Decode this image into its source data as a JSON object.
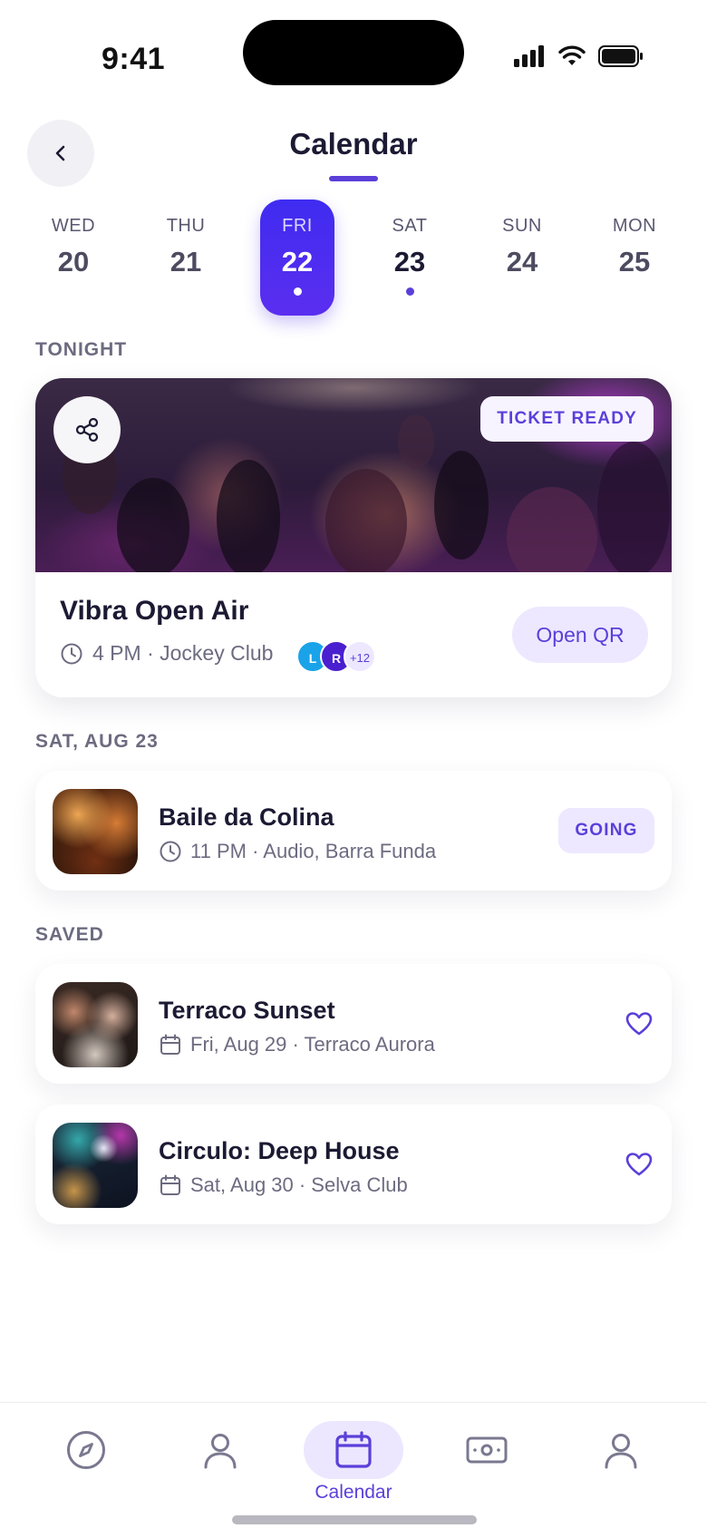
{
  "status_bar": {
    "time": "9:41"
  },
  "header": {
    "title": "Calendar"
  },
  "date_strip": [
    {
      "dow": "WED",
      "num": "20",
      "active": false,
      "dot": false
    },
    {
      "dow": "THU",
      "num": "21",
      "active": false,
      "dot": false
    },
    {
      "dow": "FRI",
      "num": "22",
      "active": true,
      "dot": true
    },
    {
      "dow": "SAT",
      "num": "23",
      "active": false,
      "dot": true
    },
    {
      "dow": "SUN",
      "num": "24",
      "active": false,
      "dot": false
    },
    {
      "dow": "MON",
      "num": "25",
      "active": false,
      "dot": false
    }
  ],
  "tonight": {
    "section_label": "TONIGHT",
    "badge": "TICKET READY",
    "title": "Vibra Open Air",
    "meta": "4 PM · Jockey Club",
    "avatars": [
      {
        "initial": "L",
        "color": "#1aa3e8"
      },
      {
        "initial": "R",
        "color": "#4a1fd0"
      }
    ],
    "avatar_more": "+12",
    "cta": "Open QR"
  },
  "upcoming": {
    "section_label": "SAT, AUG 23",
    "items": [
      {
        "title": "Baile da Colina",
        "meta": "11 PM · Audio, Barra Funda",
        "badge": "GOING"
      }
    ]
  },
  "saved": {
    "section_label": "SAVED",
    "items": [
      {
        "title": "Terraco Sunset",
        "meta": "Fri, Aug 29 · Terraco Aurora"
      },
      {
        "title": "Circulo: Deep House",
        "meta": "Sat, Aug 30 · Selva Club"
      }
    ]
  },
  "tabbar": {
    "items": [
      "compass-icon",
      "user-icon",
      "calendar-icon",
      "ticket-icon",
      "profile-icon"
    ],
    "active_label": "Calendar"
  },
  "colors": {
    "accent": "#5b3fd9",
    "accent_light": "#ede8ff",
    "text": "#1c1a33",
    "muted": "#6d6b80"
  }
}
